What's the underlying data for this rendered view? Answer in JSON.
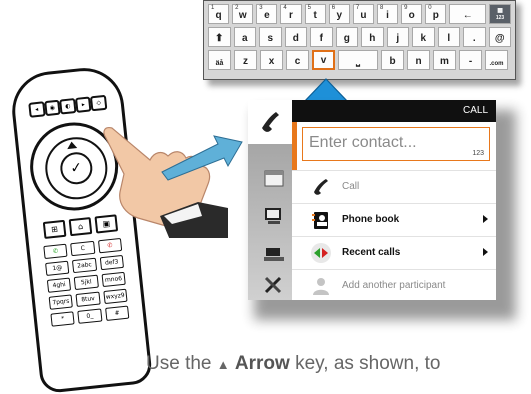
{
  "keyboard": {
    "row1": [
      {
        "char": "q",
        "sub": "1"
      },
      {
        "char": "w",
        "sub": "2"
      },
      {
        "char": "e",
        "sub": "3"
      },
      {
        "char": "r",
        "sub": "4"
      },
      {
        "char": "t",
        "sub": "5"
      },
      {
        "char": "y",
        "sub": "6"
      },
      {
        "char": "u",
        "sub": "7"
      },
      {
        "char": "i",
        "sub": "8"
      },
      {
        "char": "o",
        "sub": "9"
      },
      {
        "char": "p",
        "sub": "0"
      }
    ],
    "backspace_label": "←",
    "mode_key": {
      "icon": "grid-icon",
      "label": "123"
    },
    "row2": [
      "a",
      "s",
      "d",
      "f",
      "g",
      "h",
      "j",
      "k",
      "l",
      "."
    ],
    "at_label": "@",
    "shift_label": "⬆",
    "row3_prefix_label": "äå",
    "row3": [
      "z",
      "x",
      "c",
      "v"
    ],
    "space_label": "⎵",
    "row3_after": [
      "b",
      "n",
      "m",
      "-"
    ],
    "com_label": ".com",
    "selected_key": "v"
  },
  "panel": {
    "header_title": "CALL",
    "input_placeholder": "Enter contact...",
    "input_mode": "123",
    "options": [
      {
        "label": "Call",
        "style": "gray",
        "icon": "phone-handset-icon",
        "submenu": false
      },
      {
        "label": "Phone book",
        "style": "bold",
        "icon": "phone-book-icon",
        "submenu": true
      },
      {
        "label": "Recent calls",
        "style": "bold",
        "icon": "recent-calls-icon",
        "submenu": true
      },
      {
        "label": "Add another participant",
        "style": "gray",
        "icon": "add-participant-icon",
        "submenu": false
      }
    ]
  },
  "remote": {
    "numeric_keys": [
      {
        "label": "1@"
      },
      {
        "label": "2abc"
      },
      {
        "label": "def3"
      },
      {
        "label": "4ghi"
      },
      {
        "label": "5jkl"
      },
      {
        "label": "mno6"
      },
      {
        "label": "7pqrs"
      },
      {
        "label": "8tuv"
      },
      {
        "label": "wxyz9"
      },
      {
        "label": "*"
      },
      {
        "label": "0_"
      },
      {
        "label": "#"
      }
    ],
    "call_key": "✆",
    "clear_key": "C",
    "end_key": "✆"
  },
  "caption": {
    "prefix": "Use the",
    "key_name": "Arrow",
    "suffix": "key, as shown, to"
  },
  "colors": {
    "accent_orange": "#e8781c",
    "arrow_blue": "#1e90d8",
    "header_black": "#101010"
  }
}
